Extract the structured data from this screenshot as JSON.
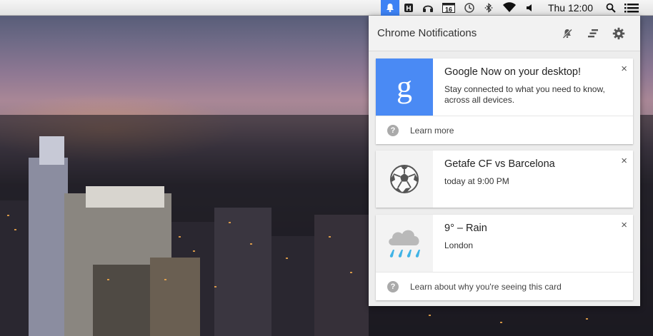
{
  "menubar": {
    "clock": "Thu 12:00",
    "status_icon_text": "16",
    "icons": [
      "notification-bell-icon",
      "app-h-icon",
      "headphones-icon",
      "calendar-icon",
      "time-machine-icon",
      "bluetooth-icon",
      "wifi-icon",
      "volume-icon",
      "spotlight-search-icon",
      "notification-center-icon"
    ]
  },
  "panel": {
    "title": "Chrome Notifications",
    "header_icons": [
      "mute-bell-icon",
      "clear-all-icon",
      "settings-gear-icon"
    ]
  },
  "cards": [
    {
      "icon": "google-g-icon",
      "title": "Google Now on your desktop!",
      "text": "Stay connected to what you need to know, across all devices.",
      "footer": "Learn more",
      "close": "×",
      "accent": "#4a8af4"
    },
    {
      "icon": "soccer-ball-icon",
      "title": "Getafe CF vs Barcelona",
      "text": "today at 9:00 PM",
      "close": "×"
    },
    {
      "icon": "rain-cloud-icon",
      "title": "9° – Rain",
      "text": "London",
      "footer": "Learn about why you're seeing this card",
      "close": "×"
    }
  ],
  "footer_help_glyph": "?",
  "google_glyph": "g"
}
